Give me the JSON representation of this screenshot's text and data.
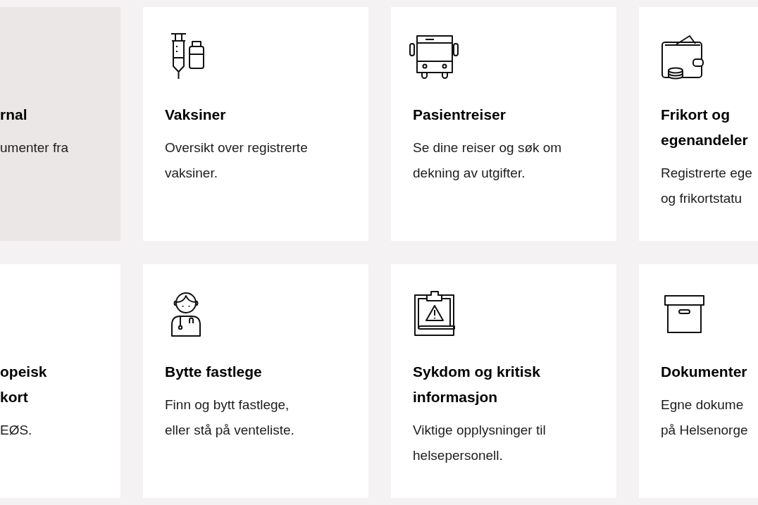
{
  "rows": [
    {
      "cards": [
        {
          "title": "rnal",
          "description": "umenter fra",
          "hovered": true
        },
        {
          "title": "Vaksiner",
          "description": "Oversikt over registrerte\nvaksiner.",
          "hovered": false
        },
        {
          "title": "Pasientreiser",
          "description": "Se dine reiser og søk om\ndekning av utgifter.",
          "hovered": false
        },
        {
          "title": "Frikort og\negenandeler",
          "description": "Registrerte ege\nog frikortstatu",
          "hovered": false
        }
      ]
    },
    {
      "cards": [
        {
          "title": "opeisk\nkort",
          "description": "EØS.",
          "hovered": false
        },
        {
          "title": "Bytte fastlege",
          "description": "Finn og bytt fastlege,\neller stå på venteliste.",
          "hovered": false
        },
        {
          "title": "Sykdom og kritisk\ninformasjon",
          "description": "Viktige opplysninger til\nhelsepersonell.",
          "hovered": false
        },
        {
          "title": "Dokumenter",
          "description": "Egne dokume\npå Helsenorge",
          "hovered": false
        }
      ]
    }
  ]
}
